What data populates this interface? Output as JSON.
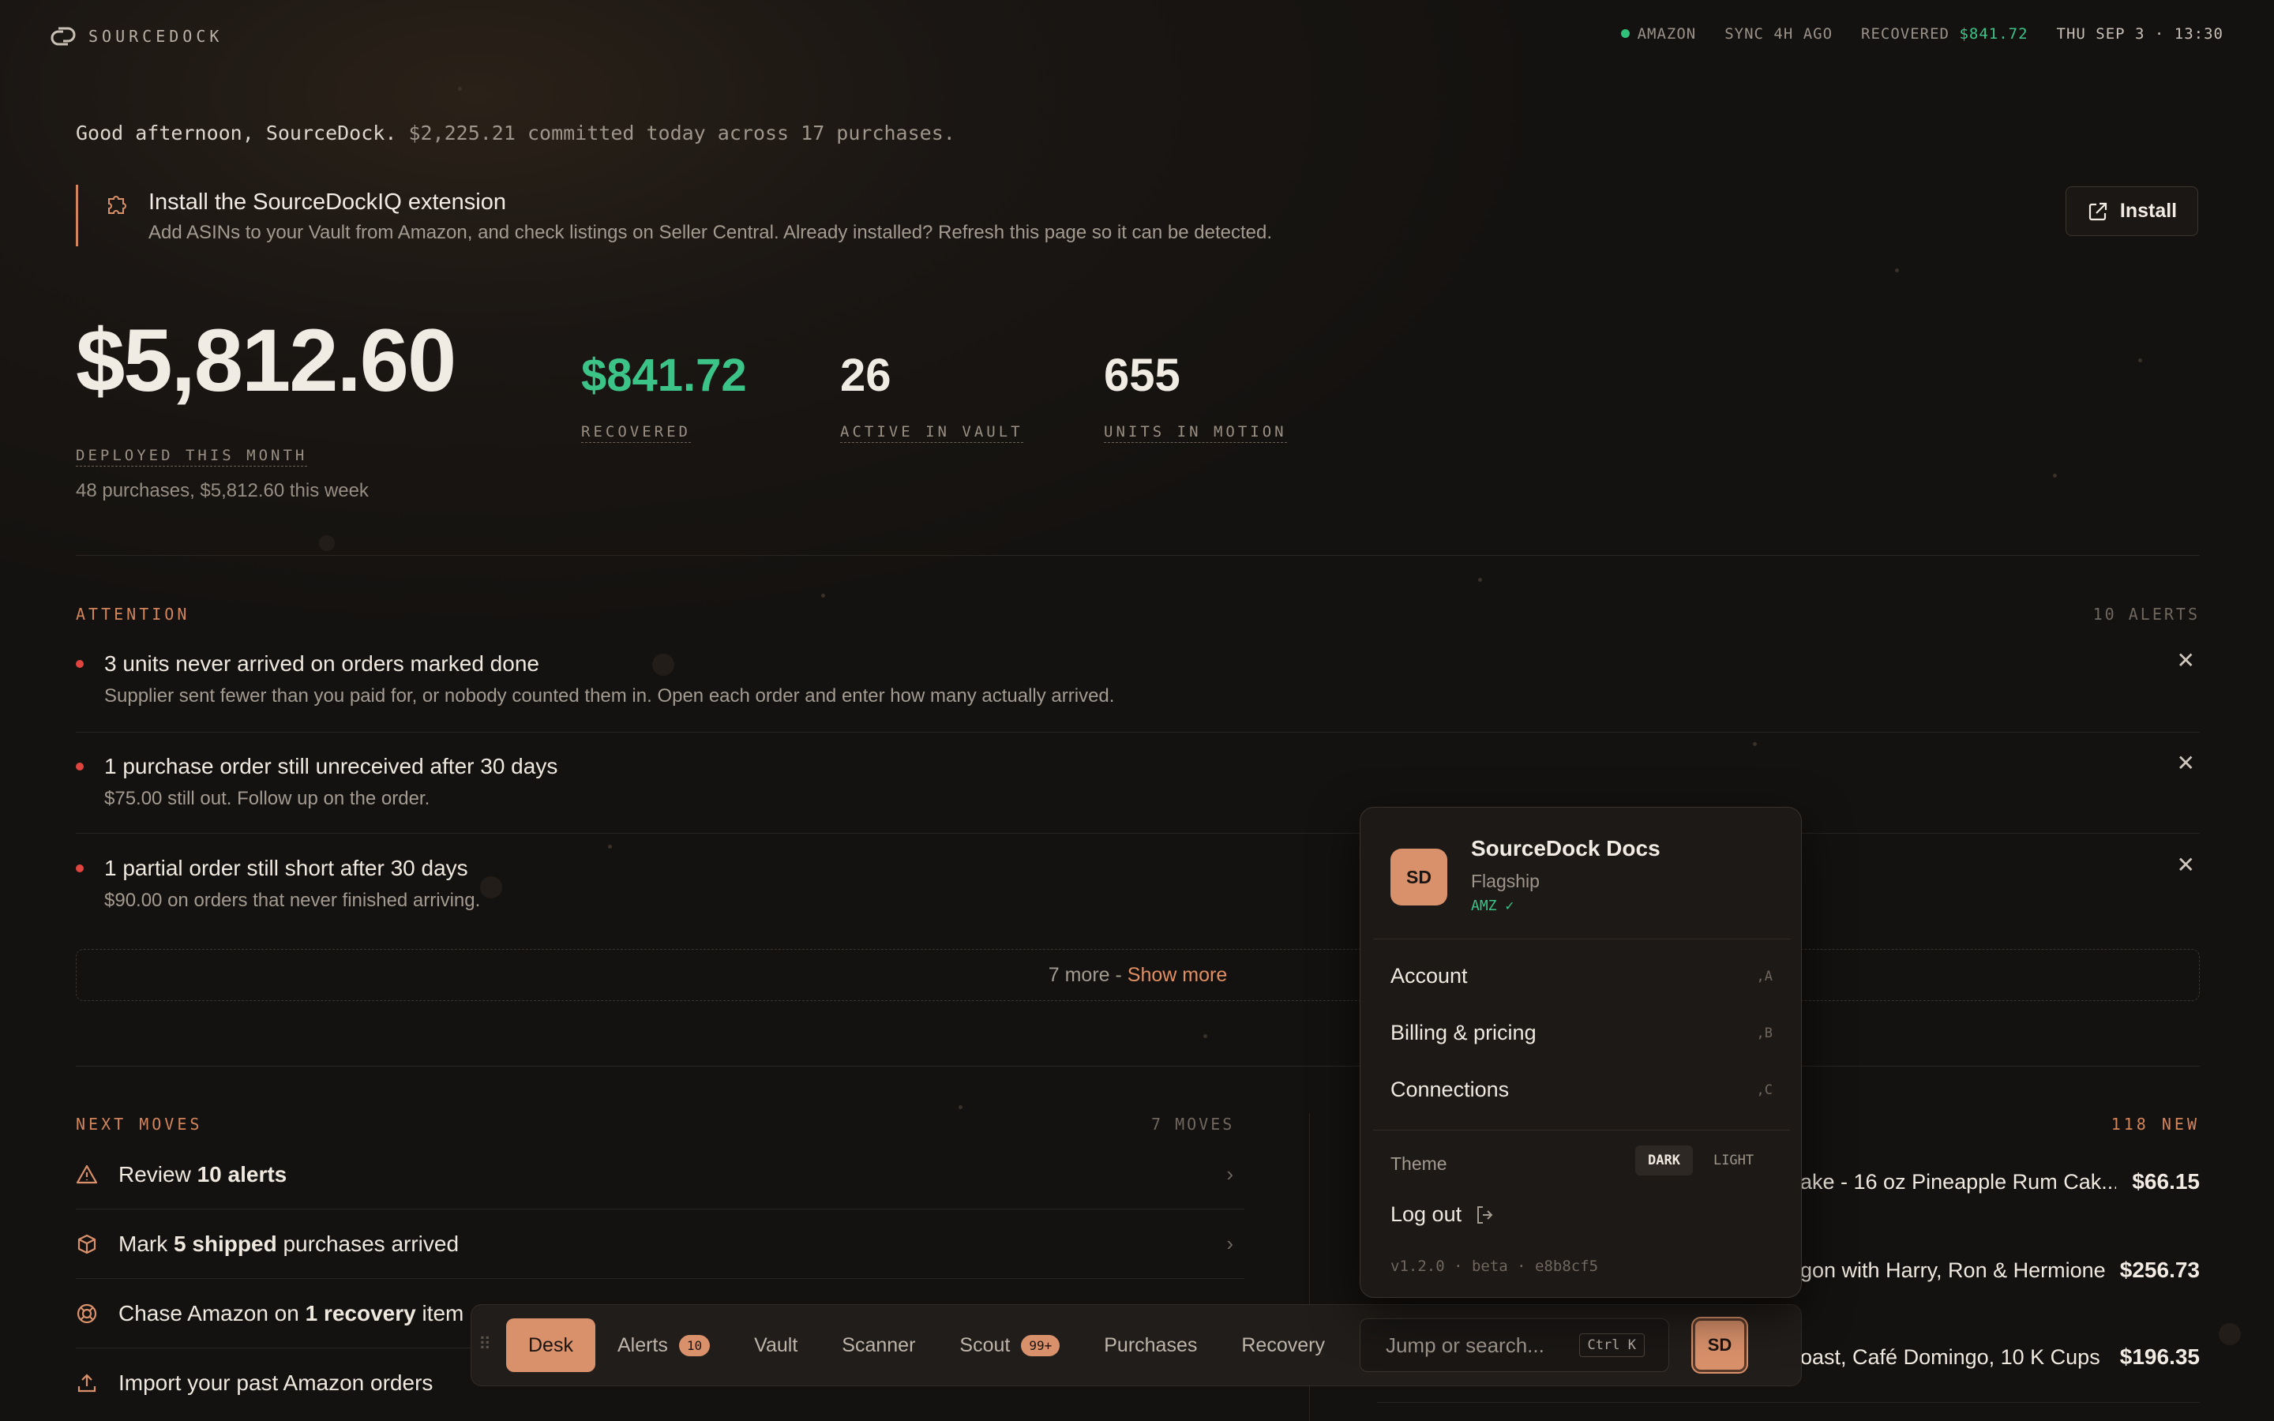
{
  "topbar": {
    "brand": "SOURCEDOCK",
    "marketplace": "AMAZON",
    "sync": "SYNC 4H AGO",
    "recovered_label": "RECOVERED",
    "recovered_value": "$841.72",
    "datetime": "THU SEP 3 · 13:30"
  },
  "greeting": {
    "hello": "Good afternoon, SourceDock.",
    "summary": "$2,225.21 committed today across 17 purchases."
  },
  "banner": {
    "title": "Install the SourceDockIQ extension",
    "subtitle": "Add ASINs to your Vault from Amazon, and check listings on Seller Central. Already installed? Refresh this page so it can be detected.",
    "button": "Install"
  },
  "stats": {
    "deployed_value": "$5,812.60",
    "deployed_label": "DEPLOYED THIS MONTH",
    "deployed_note": "48 purchases, $5,812.60 this week",
    "recovered_value": "$841.72",
    "recovered_label": "RECOVERED",
    "vault_value": "26",
    "vault_label": "ACTIVE IN VAULT",
    "units_value": "655",
    "units_label": "UNITS IN MOTION"
  },
  "attention": {
    "heading": "ATTENTION",
    "count": "10 ALERTS",
    "alerts": [
      {
        "title": "3 units never arrived on orders marked done",
        "desc": "Supplier sent fewer than you paid for, or nobody counted them in. Open each order and enter how many actually arrived."
      },
      {
        "title": "1 purchase order still unreceived after 30 days",
        "desc": "$75.00 still out. Follow up on the order."
      },
      {
        "title": "1 partial order still short after 30 days",
        "desc": "$90.00 on orders that never finished arriving."
      }
    ],
    "show_more_prefix": "7 more - ",
    "show_more_link": "Show more"
  },
  "next_moves": {
    "heading": "NEXT MOVES",
    "count": "7 MOVES",
    "items": [
      {
        "pre": "Review ",
        "bold": "10 alerts",
        "post": ""
      },
      {
        "pre": "Mark ",
        "bold": "5 shipped",
        "post": " purchases arrived"
      },
      {
        "pre": "Chase Amazon on ",
        "bold": "1 recovery",
        "post": " item"
      },
      {
        "pre": "Import your past Amazon orders",
        "bold": "",
        "post": ""
      }
    ]
  },
  "new_items": {
    "count": "118 NEW",
    "items": [
      {
        "title": "ake - 16 oz Pineapple Rum Cak...",
        "price": "$66.15"
      },
      {
        "title": "gon with Harry, Ron & Hermione",
        "price": "$256.73"
      },
      {
        "title": "oast, Café Domingo, 10 K Cups",
        "price": "$196.35"
      }
    ]
  },
  "popover": {
    "avatar": "SD",
    "name": "SourceDock Docs",
    "plan": "Flagship",
    "amz": "AMZ ✓",
    "account": "Account",
    "account_sc": ",A",
    "billing": "Billing & pricing",
    "billing_sc": ",B",
    "connections": "Connections",
    "connections_sc": ",C",
    "theme_label": "Theme",
    "theme_dark": "DARK",
    "theme_light": "LIGHT",
    "logout": "Log out",
    "version": "v1.2.0 · beta · e8b8cf5"
  },
  "dock": {
    "desk": "Desk",
    "alerts": "Alerts",
    "alerts_badge": "10",
    "vault": "Vault",
    "scanner": "Scanner",
    "scout": "Scout",
    "scout_badge": "99+",
    "purchases": "Purchases",
    "recovery": "Recovery",
    "search_placeholder": "Jump or search...",
    "search_kbd": "Ctrl K",
    "avatar": "SD"
  },
  "colors": {
    "accent": "#d9916b",
    "green": "#3cc488",
    "alert_red": "#e0443f"
  }
}
